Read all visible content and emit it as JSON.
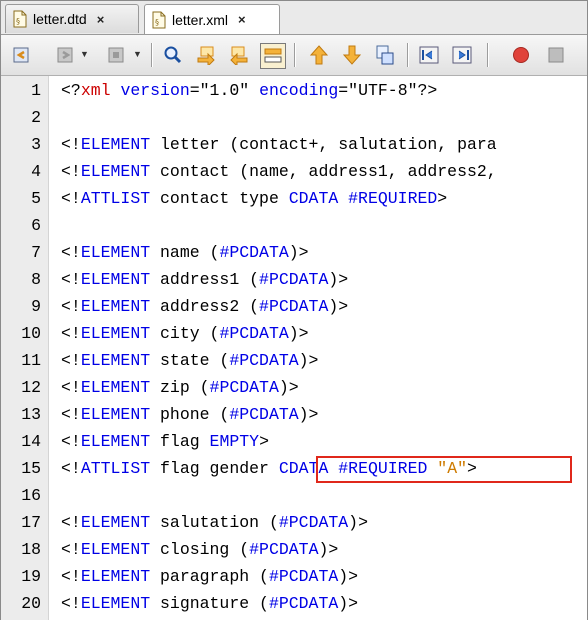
{
  "tabs": [
    {
      "label": "letter.dtd",
      "close": "×"
    },
    {
      "label": "letter.xml",
      "close": "×"
    }
  ],
  "toolbar": {
    "buttons": [
      "back-icon",
      "forward-icon",
      "last-edit-icon",
      "find-icon",
      "find-previous-icon",
      "find-next-icon",
      "toggle-highlight-icon",
      "previous-bookmark-icon",
      "next-bookmark-icon",
      "toggle-bookmark-icon",
      "shift-left-icon",
      "shift-right-icon",
      "start-macro-icon",
      "stop-macro-icon"
    ],
    "colors": {
      "macro_record": "#e0423a",
      "find": "#1a4fa0",
      "arrows": "#e8a431"
    }
  },
  "editor": {
    "lines": [
      {
        "n": "1",
        "parts": [
          [
            "t",
            "<?"
          ],
          [
            "pi",
            "xml"
          ],
          [
            "t",
            " "
          ],
          [
            "kw",
            "version"
          ],
          [
            "t",
            "=\"1.0\" "
          ],
          [
            "kw",
            "encoding"
          ],
          [
            "t",
            "=\"UTF-8\"?>"
          ]
        ]
      },
      {
        "n": "2",
        "parts": []
      },
      {
        "n": "3",
        "parts": [
          [
            "t",
            "<!"
          ],
          [
            "kw",
            "ELEMENT"
          ],
          [
            "t",
            " letter (contact+, salutation, para"
          ]
        ]
      },
      {
        "n": "4",
        "parts": [
          [
            "t",
            "<!"
          ],
          [
            "kw",
            "ELEMENT"
          ],
          [
            "t",
            " contact (name, address1, address2,"
          ]
        ]
      },
      {
        "n": "5",
        "parts": [
          [
            "t",
            "<!"
          ],
          [
            "kw",
            "ATTLIST"
          ],
          [
            "t",
            " contact type "
          ],
          [
            "kw",
            "CDATA #REQUIRED"
          ],
          [
            "t",
            ">"
          ]
        ]
      },
      {
        "n": "6",
        "parts": []
      },
      {
        "n": "7",
        "parts": [
          [
            "t",
            "<!"
          ],
          [
            "kw",
            "ELEMENT"
          ],
          [
            "t",
            " name ("
          ],
          [
            "kw",
            "#PCDATA"
          ],
          [
            "t",
            ")>"
          ]
        ]
      },
      {
        "n": "8",
        "parts": [
          [
            "t",
            "<!"
          ],
          [
            "kw",
            "ELEMENT"
          ],
          [
            "t",
            " address1 ("
          ],
          [
            "kw",
            "#PCDATA"
          ],
          [
            "t",
            ")>"
          ]
        ]
      },
      {
        "n": "9",
        "parts": [
          [
            "t",
            "<!"
          ],
          [
            "kw",
            "ELEMENT"
          ],
          [
            "t",
            " address2 ("
          ],
          [
            "kw",
            "#PCDATA"
          ],
          [
            "t",
            ")>"
          ]
        ]
      },
      {
        "n": "10",
        "parts": [
          [
            "t",
            "<!"
          ],
          [
            "kw",
            "ELEMENT"
          ],
          [
            "t",
            " city ("
          ],
          [
            "kw",
            "#PCDATA"
          ],
          [
            "t",
            ")>"
          ]
        ]
      },
      {
        "n": "11",
        "parts": [
          [
            "t",
            "<!"
          ],
          [
            "kw",
            "ELEMENT"
          ],
          [
            "t",
            " state ("
          ],
          [
            "kw",
            "#PCDATA"
          ],
          [
            "t",
            ")>"
          ]
        ]
      },
      {
        "n": "12",
        "parts": [
          [
            "t",
            "<!"
          ],
          [
            "kw",
            "ELEMENT"
          ],
          [
            "t",
            " zip ("
          ],
          [
            "kw",
            "#PCDATA"
          ],
          [
            "t",
            ")>"
          ]
        ]
      },
      {
        "n": "13",
        "parts": [
          [
            "t",
            "<!"
          ],
          [
            "kw",
            "ELEMENT"
          ],
          [
            "t",
            " phone ("
          ],
          [
            "kw",
            "#PCDATA"
          ],
          [
            "t",
            ")>"
          ]
        ]
      },
      {
        "n": "14",
        "parts": [
          [
            "t",
            "<!"
          ],
          [
            "kw",
            "ELEMENT"
          ],
          [
            "t",
            " flag "
          ],
          [
            "kw",
            "EMPTY"
          ],
          [
            "t",
            ">"
          ]
        ]
      },
      {
        "n": "15",
        "parts": [
          [
            "t",
            "<!"
          ],
          [
            "kw",
            "ATTLIST"
          ],
          [
            "t",
            " flag gender "
          ],
          [
            "kw",
            "CDATA #REQUIRED"
          ],
          [
            "t",
            " "
          ],
          [
            "str",
            "\"A\""
          ],
          [
            "t",
            ">"
          ]
        ]
      },
      {
        "n": "16",
        "parts": []
      },
      {
        "n": "17",
        "parts": [
          [
            "t",
            "<!"
          ],
          [
            "kw",
            "ELEMENT"
          ],
          [
            "t",
            " salutation ("
          ],
          [
            "kw",
            "#PCDATA"
          ],
          [
            "t",
            ")>"
          ]
        ]
      },
      {
        "n": "18",
        "parts": [
          [
            "t",
            "<!"
          ],
          [
            "kw",
            "ELEMENT"
          ],
          [
            "t",
            " closing ("
          ],
          [
            "kw",
            "#PCDATA"
          ],
          [
            "t",
            ")>"
          ]
        ]
      },
      {
        "n": "19",
        "parts": [
          [
            "t",
            "<!"
          ],
          [
            "kw",
            "ELEMENT"
          ],
          [
            "t",
            " paragraph ("
          ],
          [
            "kw",
            "#PCDATA"
          ],
          [
            "t",
            ")>"
          ]
        ]
      },
      {
        "n": "20",
        "parts": [
          [
            "t",
            "<!"
          ],
          [
            "kw",
            "ELEMENT"
          ],
          [
            "t",
            " signature ("
          ],
          [
            "kw",
            "#PCDATA"
          ],
          [
            "t",
            ")>"
          ]
        ]
      }
    ],
    "highlight": {
      "line": "15",
      "text": "CDATA #REQUIRED \"A\">",
      "color": "#e0281b"
    }
  }
}
